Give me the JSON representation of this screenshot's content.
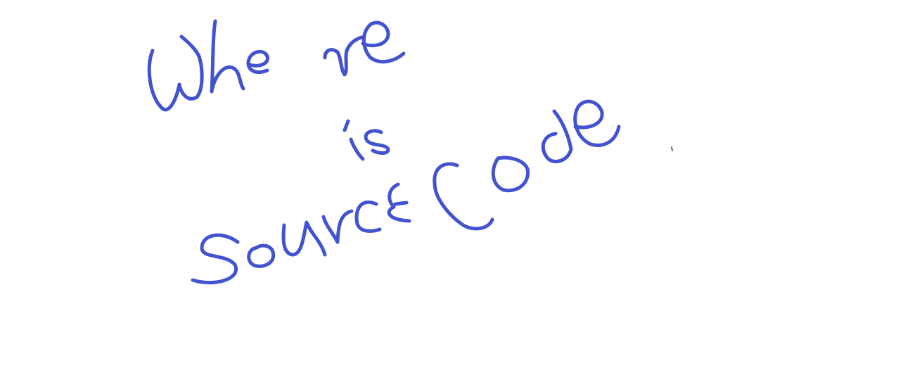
{
  "handwriting": {
    "text": "Where is Source Code",
    "words": [
      "Where",
      "is",
      "Source",
      "Code"
    ],
    "ink_color": "#4352CF",
    "speck_color": "#222222"
  }
}
